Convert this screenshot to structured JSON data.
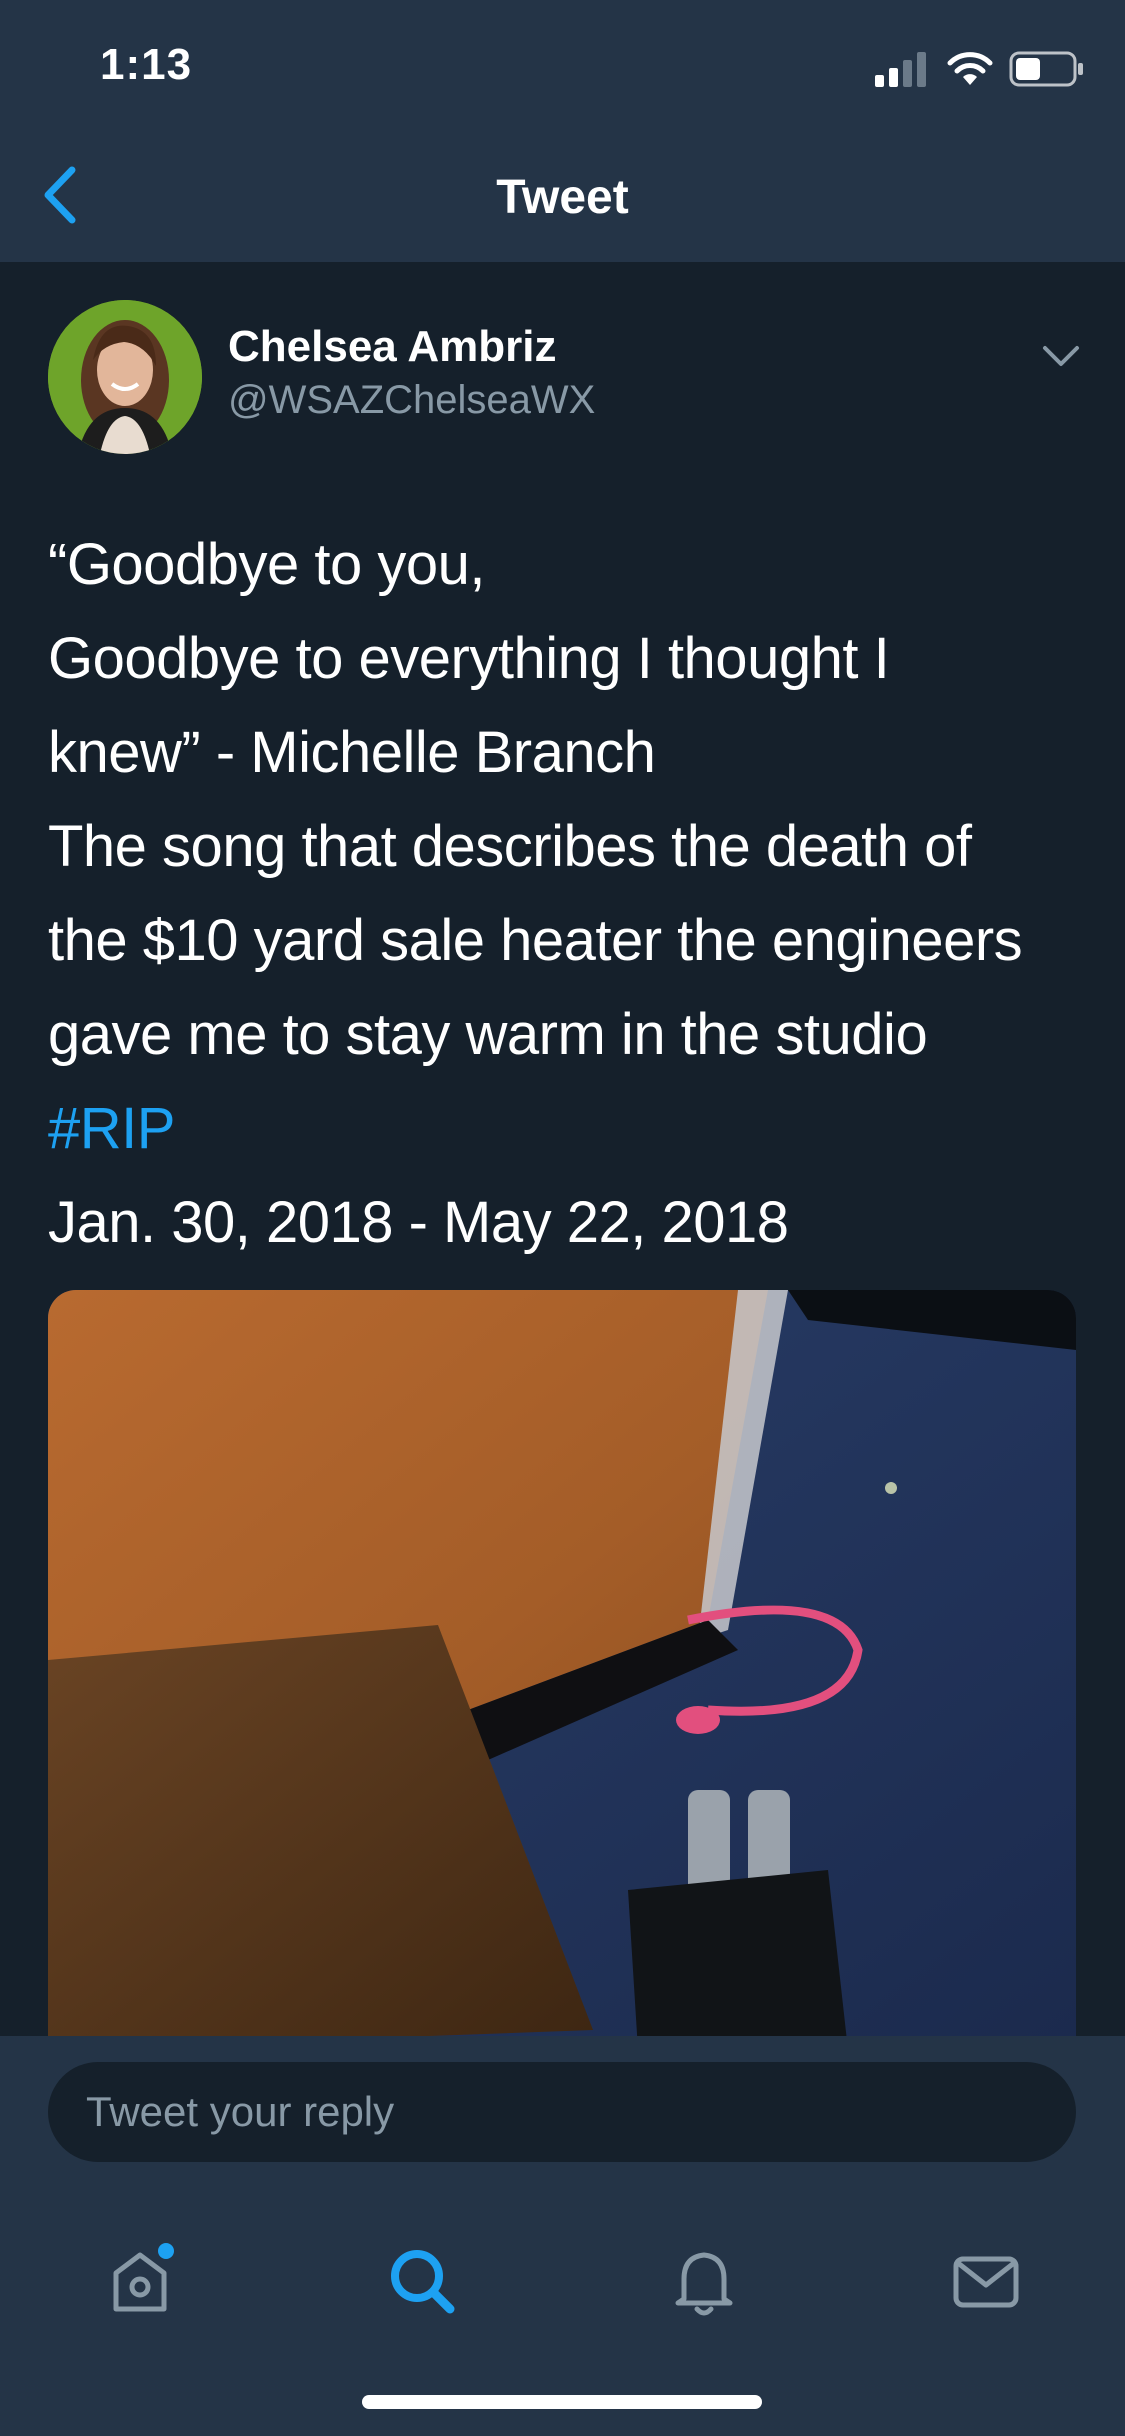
{
  "status_bar": {
    "time": "1:13"
  },
  "nav": {
    "title": "Tweet",
    "back_icon": "chevron-left-icon"
  },
  "tweet": {
    "author_name": "Chelsea Ambriz",
    "author_handle": "@WSAZChelseaWX",
    "lines": [
      "“Goodbye to you,",
      "Goodbye to everything I thought I",
      "knew” - Michelle Branch",
      "The song that describes the death of",
      "the $10 yard sale heater the engineers",
      "gave me to stay warm in the studio"
    ],
    "hashtag": "#RIP",
    "date_line": "Jan. 30, 2018 - May 22, 2018"
  },
  "reply": {
    "placeholder": "Tweet your reply"
  },
  "tabbar": {
    "items": [
      {
        "icon": "home-icon",
        "has_dot": true
      },
      {
        "icon": "search-icon",
        "active": true
      },
      {
        "icon": "bell-icon"
      },
      {
        "icon": "mail-icon"
      }
    ]
  },
  "colors": {
    "background": "#15202b",
    "header": "#243447",
    "accent": "#1da1f2",
    "secondary_text": "#8899a6"
  }
}
